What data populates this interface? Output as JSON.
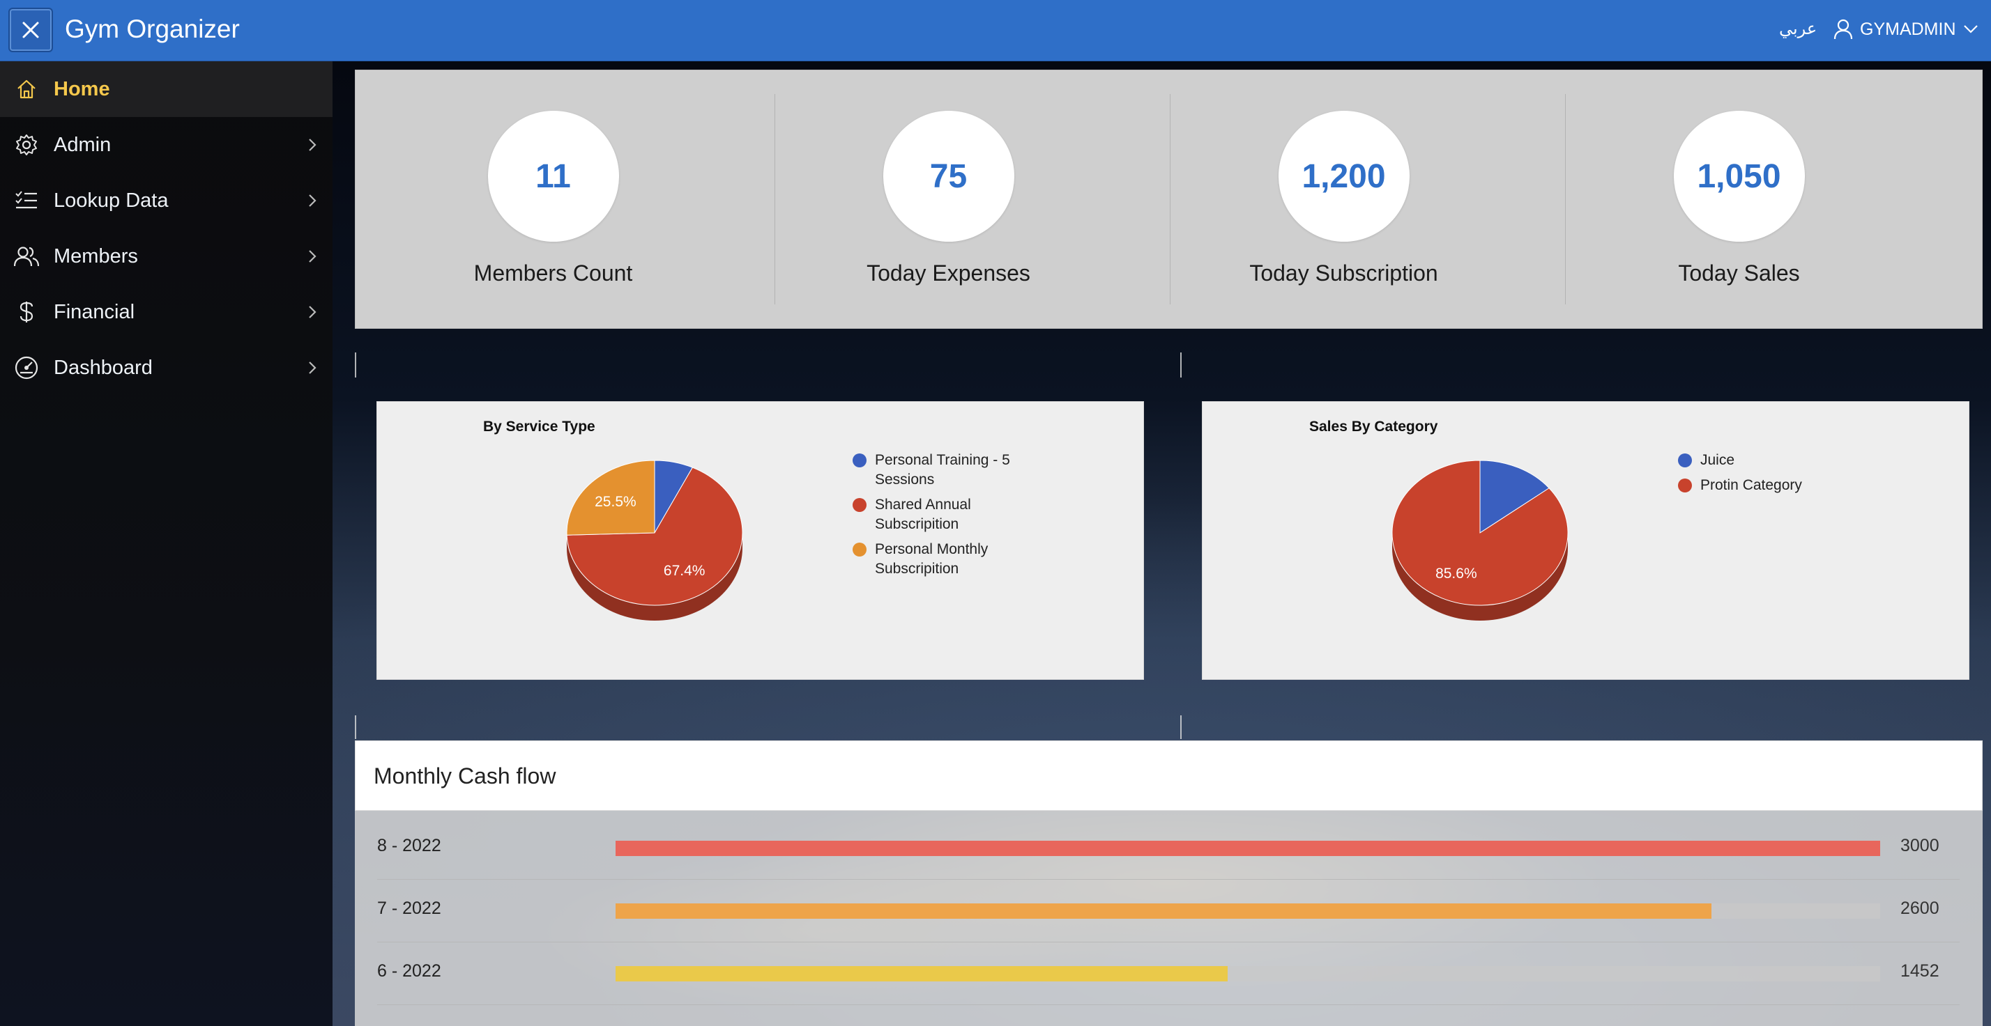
{
  "header": {
    "app_title": "Gym Organizer",
    "language_link": "عربي",
    "username": "GYMADMIN",
    "icons": {
      "toggle": "close-icon",
      "user": "user-icon",
      "dropdown": "chevron-down-icon"
    },
    "bar_color": "#2f6fc8"
  },
  "sidebar": {
    "items": [
      {
        "label": "Home",
        "icon": "home-icon",
        "active": true
      },
      {
        "label": "Admin",
        "icon": "gear-icon",
        "has_children": true
      },
      {
        "label": "Lookup Data",
        "icon": "checklist-icon",
        "has_children": true
      },
      {
        "label": "Members",
        "icon": "users-icon",
        "has_children": true
      },
      {
        "label": "Financial",
        "icon": "dollar-icon",
        "has_children": true
      },
      {
        "label": "Dashboard",
        "icon": "dashboard-gauge-icon",
        "has_children": true
      }
    ],
    "active_color": "#f5c84c"
  },
  "summary": {
    "stats": [
      {
        "value": "11",
        "label": "Members Count"
      },
      {
        "value": "75",
        "label": "Today Expenses"
      },
      {
        "value": "1,200",
        "label": "Today Subscription"
      },
      {
        "value": "1,050",
        "label": "Today Sales"
      }
    ],
    "value_color": "#2f6fc8"
  },
  "chart_data": [
    {
      "type": "pie",
      "title": "By Service Type",
      "categories": [
        "Personal Training - 5 Sessions",
        "Shared Annual Subscripition",
        "Personal Monthly Subscripition"
      ],
      "values": [
        7.1,
        67.4,
        25.5
      ],
      "data_labels": [
        "",
        "67.4%",
        "25.5%"
      ],
      "colors": [
        "#3a5fbf",
        "#c8422c",
        "#e4912f"
      ],
      "legend": "right"
    },
    {
      "type": "pie",
      "title": "Sales By Category",
      "categories": [
        "Juice",
        "Protin Category"
      ],
      "values": [
        14.4,
        85.6
      ],
      "data_labels": [
        "",
        "85.6%"
      ],
      "colors": [
        "#3a5fbf",
        "#c8422c"
      ],
      "legend": "right"
    }
  ],
  "cash_flow": {
    "title": "Monthly Cash flow",
    "max": 3000,
    "rows": [
      {
        "month": "8 - 2022",
        "value": 3000,
        "display": "3000",
        "color": "#e8665c"
      },
      {
        "month": "7 - 2022",
        "value": 2600,
        "display": "2600",
        "color": "#eea44a"
      },
      {
        "month": "6 - 2022",
        "value": 1452,
        "display": "1452",
        "color": "#eac94a"
      }
    ]
  }
}
